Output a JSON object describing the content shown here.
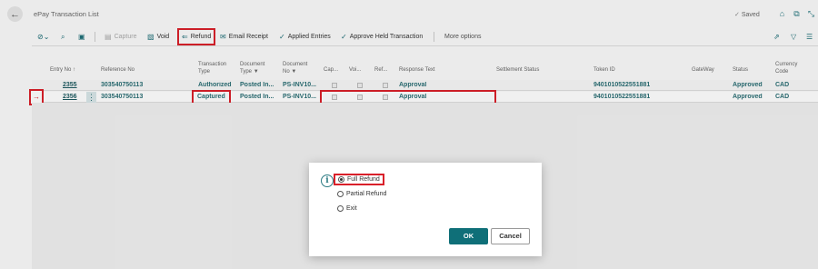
{
  "header": {
    "title": "ePay Transaction List",
    "saved": "Saved"
  },
  "toolbar": {
    "capture": "Capture",
    "void": "Void",
    "refund": "Refund",
    "email_receipt": "Email Receipt",
    "applied_entries": "Applied Entries",
    "approve_held": "Approve Held Transaction",
    "more_options": "More options"
  },
  "table": {
    "headers": {
      "entry_no": "Entry No ↑",
      "reference_no": "Reference No",
      "transaction_type_1": "Transaction",
      "transaction_type_2": "Type",
      "document_type_1": "Document",
      "document_type_2": "Type",
      "document_no_1": "Document",
      "document_no_2": "No",
      "cap": "Cap...",
      "voi": "Voi...",
      "ref": "Ref...",
      "response_text": "Response Text",
      "settlement_status": "Settlement Status",
      "token_id": "Token ID",
      "gateway": "GateWay",
      "status": "Status",
      "currency_1": "Currency",
      "currency_2": "Code"
    },
    "rows": [
      {
        "entry_no": "2355",
        "reference_no": "303540750113",
        "transaction_type": "Authorized",
        "document_type": "Posted In...",
        "document_no": "PS-INV10...",
        "response_text": "Approval",
        "token_id": "9401010522551881",
        "status": "Approved",
        "currency": "CAD"
      },
      {
        "entry_no": "2356",
        "reference_no": "303540750113",
        "transaction_type": "Captured",
        "document_type": "Posted In...",
        "document_no": "PS-INV10...",
        "response_text": "Approval",
        "token_id": "9401010522551881",
        "status": "Approved",
        "currency": "CAD"
      }
    ]
  },
  "dialog": {
    "options": [
      "Full Refund",
      "Partial Refund",
      "Exit"
    ],
    "selected": "Full Refund",
    "ok": "OK",
    "cancel": "Cancel"
  }
}
